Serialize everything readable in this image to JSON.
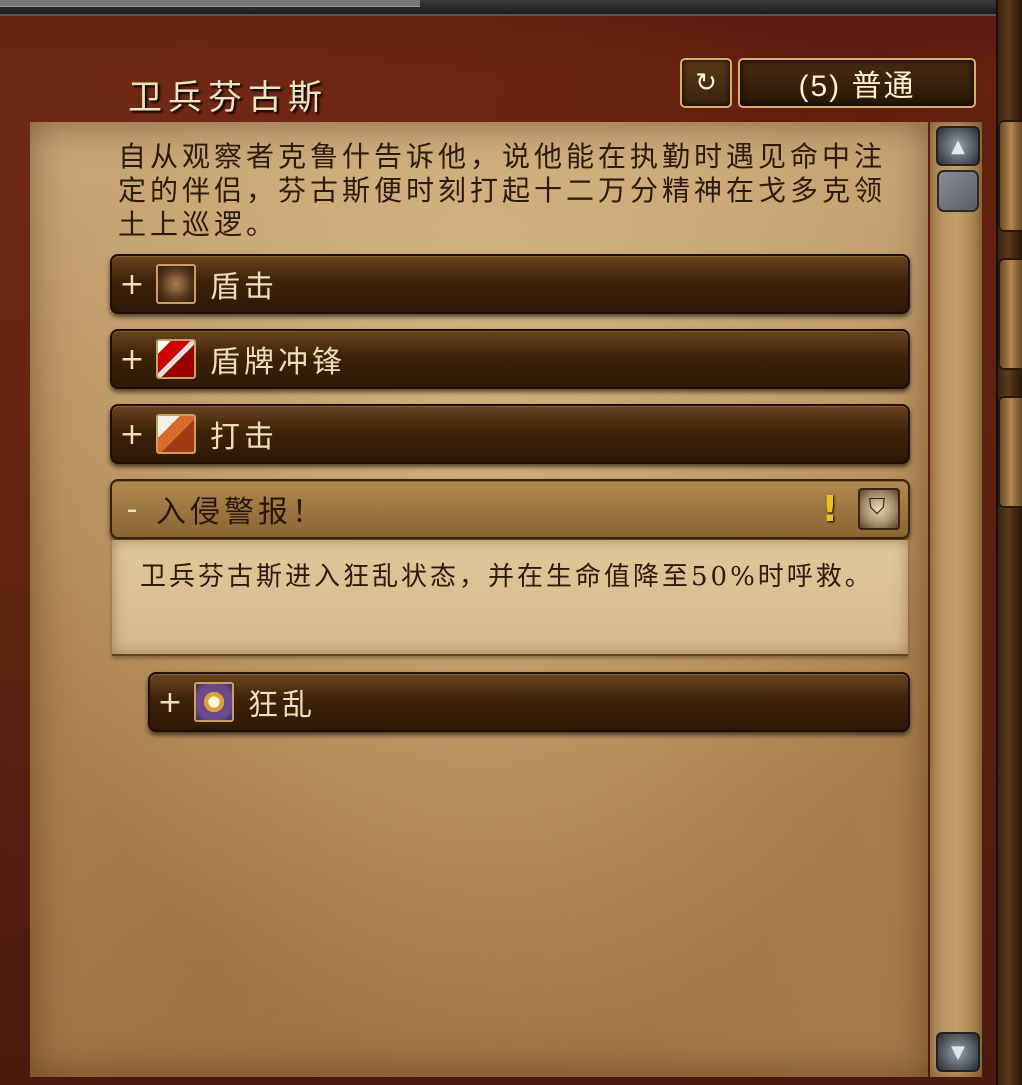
{
  "header": {
    "title": "卫兵芬古斯",
    "reset_icon": "↻",
    "difficulty": "(5) 普通"
  },
  "lore": "自从观察者克鲁什告诉他，说他能在执勤时遇见命中注定的伴侣，芬古斯便时刻打起十二万分精神在戈多克领土上巡逻。",
  "abilities": [
    {
      "toggle": "+",
      "label": "盾击",
      "icon": "shield-bash-icon"
    },
    {
      "toggle": "+",
      "label": "盾牌冲锋",
      "icon": "shield-charge-icon"
    },
    {
      "toggle": "+",
      "label": "打击",
      "icon": "strike-icon"
    },
    {
      "toggle": "-",
      "label": "入侵警报！",
      "alert_icon": "!",
      "role_icon": "⛉",
      "description": "卫兵芬古斯进入狂乱状态，并在生命值降至50%时呼救。"
    },
    {
      "toggle": "+",
      "label": "狂乱",
      "icon": "frenzy-icon"
    }
  ],
  "scrollbar": {
    "up_icon": "▲",
    "down_icon": "▼"
  }
}
